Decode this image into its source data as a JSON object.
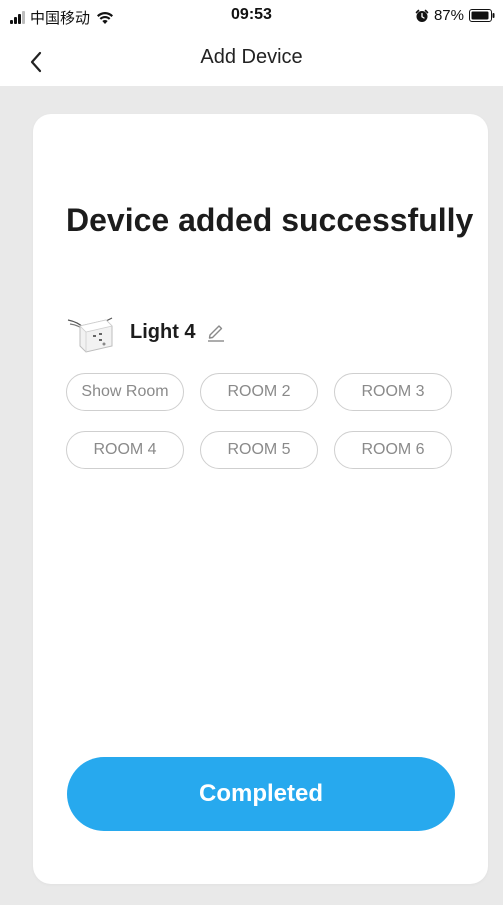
{
  "status_bar": {
    "carrier": "中国移动",
    "time": "09:53",
    "battery": "87%"
  },
  "nav": {
    "title": "Add Device"
  },
  "main": {
    "headline": "Device added successfully",
    "device": {
      "name": "Light 4"
    },
    "rooms": [
      "Show Room",
      "ROOM 2",
      "ROOM 3",
      "ROOM 4",
      "ROOM 5",
      "ROOM 6"
    ],
    "completed_label": "Completed"
  },
  "colors": {
    "accent": "#27a9ee",
    "background": "#e9e9e9",
    "chip_border": "#cfcfcf",
    "chip_text": "#8a8a8a"
  },
  "icons": [
    "signal-icon",
    "wifi-icon",
    "alarm-icon",
    "battery-icon",
    "back-chevron-icon",
    "device-module-icon",
    "edit-pencil-icon"
  ]
}
